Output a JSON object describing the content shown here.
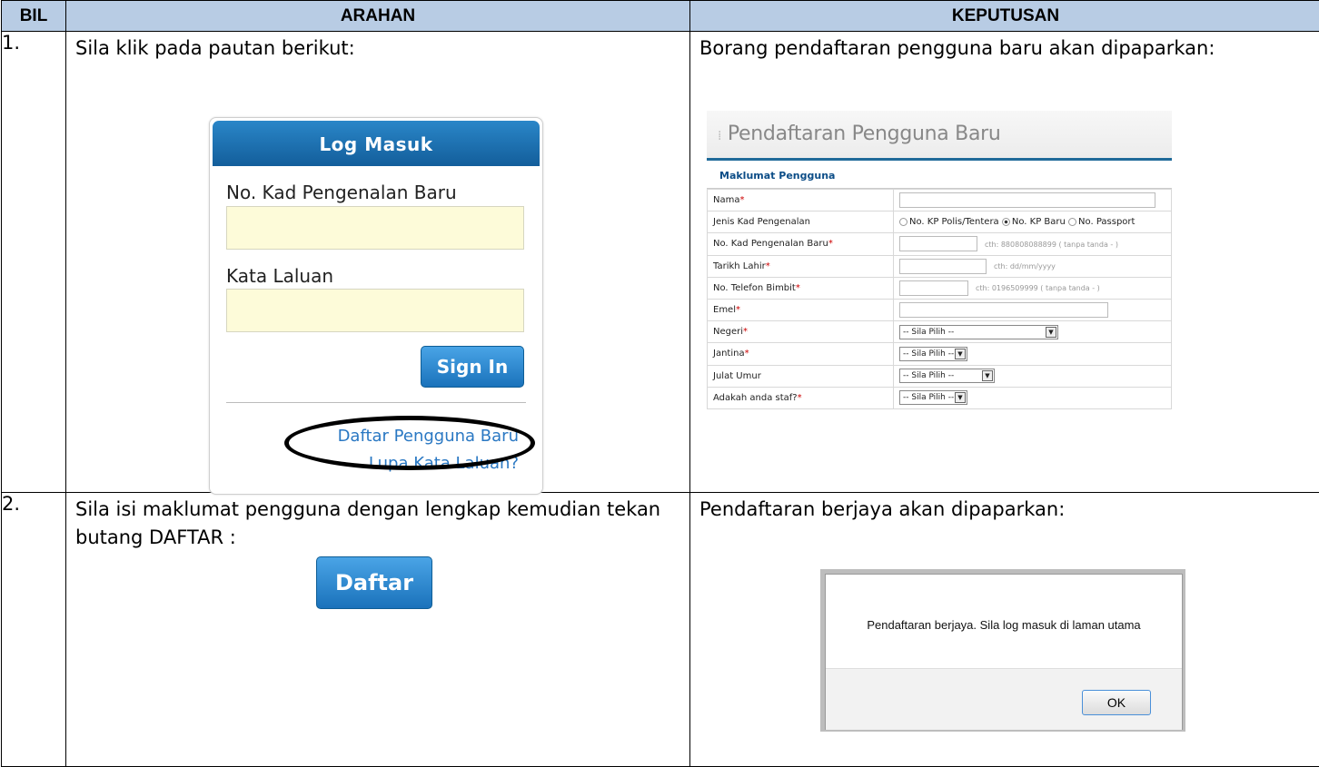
{
  "headers": {
    "bil": "BIL",
    "arahan": "ARAHAN",
    "keputusan": "KEPUTUSAN"
  },
  "row1": {
    "num": "1.",
    "arahan_text": "Sila klik pada pautan berikut:",
    "keputusan_text": "Borang pendaftaran pengguna baru akan dipaparkan:",
    "login": {
      "title": "Log Masuk",
      "ic_label": "No. Kad Pengenalan Baru",
      "password_label": "Kata Laluan",
      "ic_value": "",
      "password_value": "",
      "signin_label": "Sign In",
      "register_link": "Daftar Pengguna Baru",
      "forgot_link": "Lupa Kata Laluan?"
    },
    "form": {
      "title": "Pendaftaran Pengguna Baru",
      "section": "Maklumat Pengguna",
      "required_mark": "*",
      "rows": {
        "nama": "Nama",
        "jenis": "Jenis Kad Pengenalan",
        "ic": "No. Kad Pengenalan Baru",
        "tarikh": "Tarikh Lahir",
        "telefon": "No. Telefon Bimbit",
        "emel": "Emel",
        "negeri": "Negeri",
        "jantina": "Jantina",
        "julat": "Julat Umur",
        "staf": "Adakah anda staf?"
      },
      "jenis_options": [
        "No. KP Polis/Tentera",
        "No. KP Baru",
        "No. Passport"
      ],
      "jenis_selected": "No. KP Baru",
      "ic_hint": "cth: 880808088899 ( tanpa tanda - )",
      "tarikh_hint": "cth: dd/mm/yyyy",
      "telefon_hint": "cth: 0196509999 ( tanpa tanda - )",
      "select_placeholder": "-- Sila Pilih --"
    }
  },
  "row2": {
    "num": "2.",
    "arahan_text": "Sila isi maklumat pengguna dengan lengkap kemudian tekan butang DAFTAR :",
    "daftar_label": "Daftar",
    "keputusan_text": "Pendaftaran berjaya akan dipaparkan:",
    "dialog": {
      "message": "Pendaftaran berjaya. Sila log masuk di laman utama",
      "ok_label": "OK"
    }
  },
  "colors": {
    "header_bg": "#b8cce4",
    "accent_blue": "#1a72bb",
    "input_yellow": "#fdfbd9"
  }
}
